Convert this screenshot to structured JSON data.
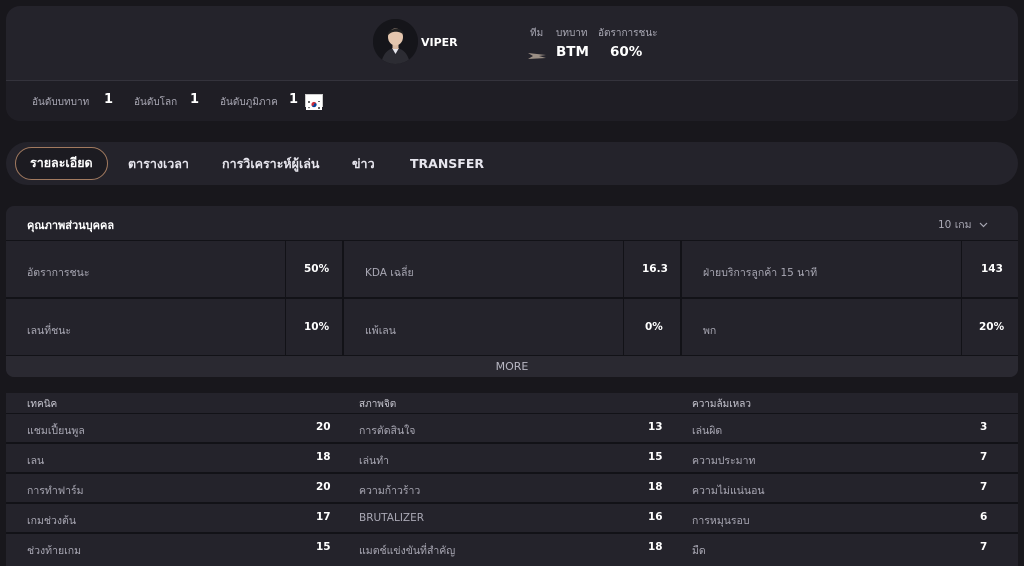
{
  "player": {
    "name": "VIPER",
    "team_label": "ทีม",
    "role_label": "บทบาท",
    "winrate_label": "อัตราการชนะ",
    "team": "BTM",
    "winrate": "60%"
  },
  "ranks": [
    {
      "label": "อันดับบทบาท",
      "value": "1"
    },
    {
      "label": "อันดับโลก",
      "value": "1"
    },
    {
      "label": "อันดับภูมิภาค",
      "value": "1"
    }
  ],
  "tabs": [
    "รายละเอียด",
    "ตารางเวลา",
    "การวิเคราะห์ผู้เล่น",
    "ข่าว",
    "TRANSFER"
  ],
  "personal": {
    "title": "คุณภาพส่วนบุคคล",
    "games": "10 เกม",
    "more": "MORE",
    "stats": [
      {
        "label": "อัตราการชนะ",
        "value": "50%"
      },
      {
        "label": "KDA เฉลี่ย",
        "value": "16.3"
      },
      {
        "label": "ฝ่ายบริการลูกค้า 15 นาที",
        "value": "143"
      },
      {
        "label": "เลนที่ชนะ",
        "value": "10%"
      },
      {
        "label": "แพ้เลน",
        "value": "0%"
      },
      {
        "label": "พก",
        "value": "20%"
      }
    ]
  },
  "categories": [
    {
      "title": "เทคนิค",
      "items": [
        {
          "label": "แชมเปี้ยนพูล",
          "value": "20"
        },
        {
          "label": "เลน",
          "value": "18"
        },
        {
          "label": "การทำฟาร์ม",
          "value": "20"
        },
        {
          "label": "เกมช่วงต้น",
          "value": "17"
        },
        {
          "label": "ช่วงท้ายเกม",
          "value": "15"
        }
      ]
    },
    {
      "title": "สภาพจิต",
      "items": [
        {
          "label": "การตัดสินใจ",
          "value": "13"
        },
        {
          "label": "เล่นทำ",
          "value": "15"
        },
        {
          "label": "ความก้าวร้าว",
          "value": "18"
        },
        {
          "label": "BRUTALIZER",
          "value": "16"
        },
        {
          "label": "แมตช์แข่งขันที่สำคัญ",
          "value": "18"
        }
      ]
    },
    {
      "title": "ความล้มเหลว",
      "items": [
        {
          "label": "เล่นผิด",
          "value": "3"
        },
        {
          "label": "ความประมาท",
          "value": "7"
        },
        {
          "label": "ความไม่แน่นอน",
          "value": "7"
        },
        {
          "label": "การหมุนรอบ",
          "value": "6"
        },
        {
          "label": "มืด",
          "value": "7"
        }
      ]
    }
  ],
  "colors": {
    "background": "#18171c",
    "card": "#24232b",
    "active_tab_border": "#a27a5f"
  }
}
